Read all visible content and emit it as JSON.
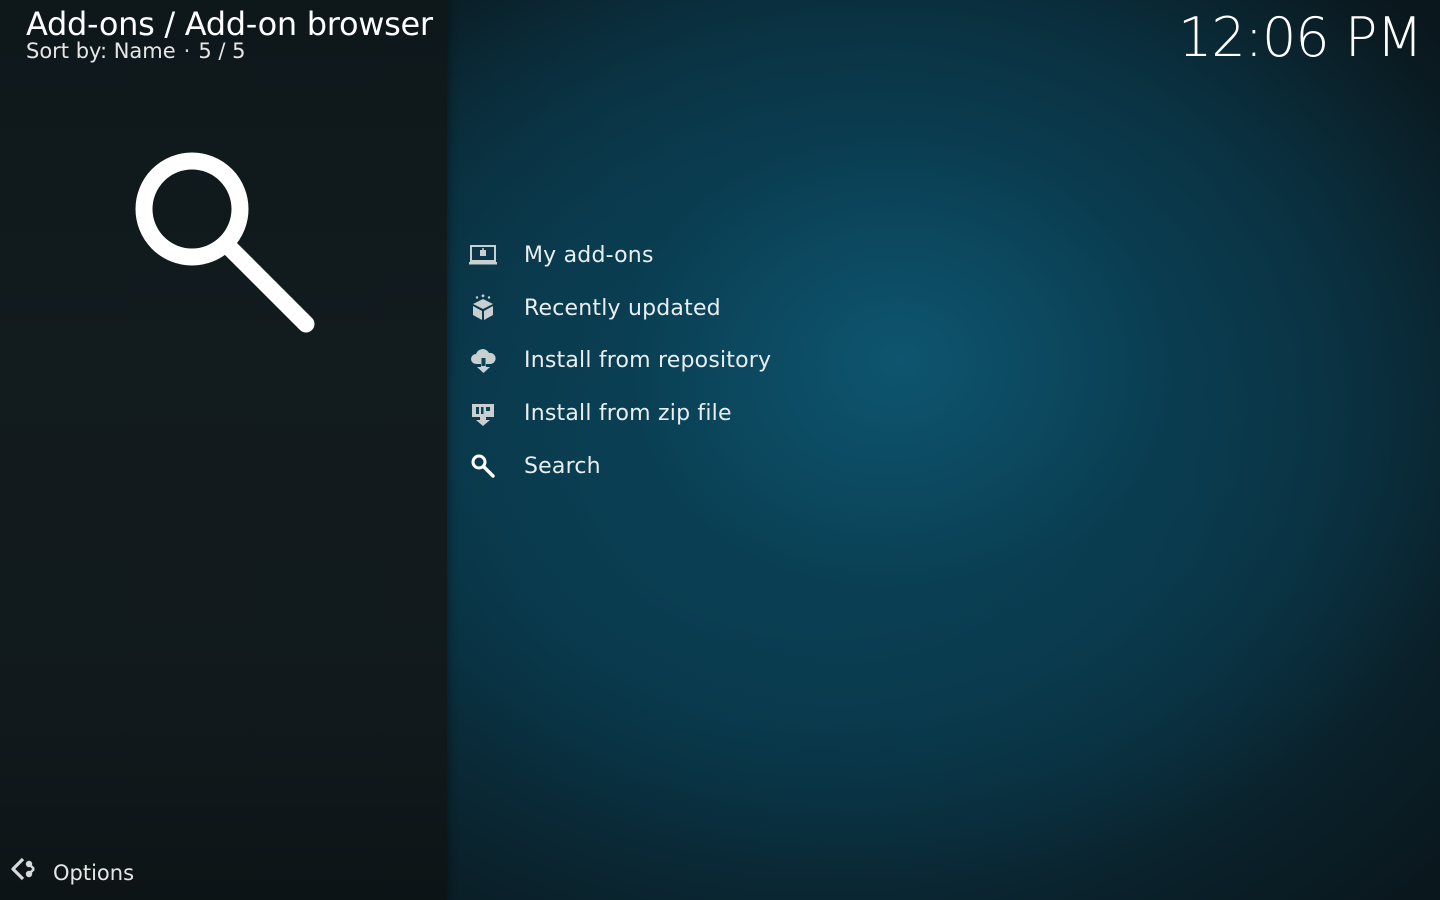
{
  "header": {
    "title": "Add-ons / Add-on browser",
    "sort_label": "Sort by: Name",
    "separator": "·",
    "count": "5 / 5"
  },
  "clock": "12:06 PM",
  "preview": {
    "icon": "search-icon"
  },
  "menu": {
    "items": [
      {
        "label": "My add-ons",
        "icon": "addons-monitor-icon"
      },
      {
        "label": "Recently updated",
        "icon": "box-update-icon"
      },
      {
        "label": "Install from repository",
        "icon": "cloud-download-icon"
      },
      {
        "label": "Install from zip file",
        "icon": "zip-download-icon"
      },
      {
        "label": "Search",
        "icon": "search-icon"
      }
    ]
  },
  "footer": {
    "options_label": "Options",
    "options_icon": "options-icon"
  },
  "colors": {
    "background_accent": "#0a4a60",
    "side_panel": "#11191c",
    "text_primary": "#ffffff",
    "icon_color": "#c9cfd1"
  }
}
